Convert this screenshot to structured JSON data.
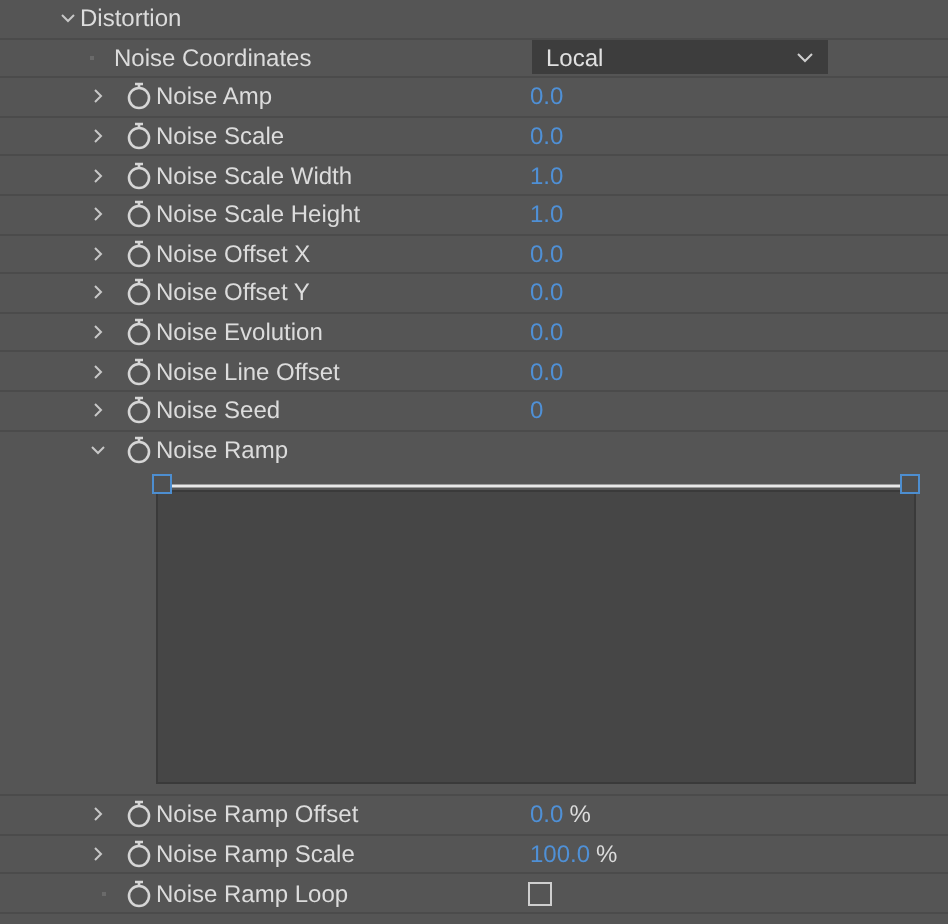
{
  "section": {
    "title": "Distortion",
    "expanded": true
  },
  "rows": [
    {
      "kind": "dropdown",
      "label": "Noise Coordinates",
      "value": "Local"
    },
    {
      "kind": "number",
      "label": "Noise Amp",
      "value": "0.0",
      "expanded": false
    },
    {
      "kind": "number",
      "label": "Noise Scale",
      "value": "0.0",
      "expanded": false
    },
    {
      "kind": "number",
      "label": "Noise Scale Width",
      "value": "1.0",
      "expanded": false
    },
    {
      "kind": "number",
      "label": "Noise Scale Height",
      "value": "1.0",
      "expanded": false
    },
    {
      "kind": "number",
      "label": "Noise Offset X",
      "value": "0.0",
      "expanded": false
    },
    {
      "kind": "number",
      "label": "Noise Offset Y",
      "value": "0.0",
      "expanded": false
    },
    {
      "kind": "number",
      "label": "Noise Evolution",
      "value": "0.0",
      "expanded": false
    },
    {
      "kind": "number",
      "label": "Noise Line Offset",
      "value": "0.0",
      "expanded": false
    },
    {
      "kind": "number",
      "label": "Noise Seed",
      "value": "0",
      "expanded": false
    },
    {
      "kind": "ramp",
      "label": "Noise Ramp",
      "expanded": true
    },
    {
      "kind": "number",
      "label": "Noise Ramp Offset",
      "value": "0.0",
      "unit": "%",
      "expanded": false
    },
    {
      "kind": "number",
      "label": "Noise Ramp Scale",
      "value": "100.0",
      "unit": "%",
      "expanded": false
    },
    {
      "kind": "checkbox",
      "label": "Noise Ramp Loop",
      "checked": false
    }
  ]
}
